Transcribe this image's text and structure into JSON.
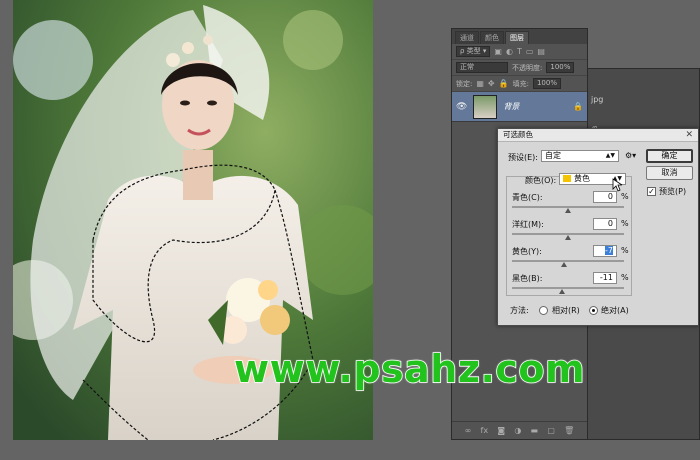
{
  "layers_panel": {
    "tabs": [
      "通道",
      "颜色",
      "图层"
    ],
    "active_tab": "图层",
    "filter_kind": "类型",
    "blend_mode": "正常",
    "opacity_label": "不透明度:",
    "opacity_value": "100%",
    "lock_label": "锁定:",
    "fill_label": "填充:",
    "fill_value": "100%",
    "layer_name": "背景",
    "footer_icons": [
      "link-icon",
      "fx-icon",
      "mask-icon",
      "adjustment-icon",
      "group-icon",
      "new-layer-icon",
      "trash-icon"
    ]
  },
  "back_panel": {
    "text_1": "jpg",
    "text_2": "像"
  },
  "dialog": {
    "title": "可选颜色",
    "preset_label": "预设(E):",
    "preset_value": "自定",
    "ok_label": "确定",
    "cancel_label": "取消",
    "preview_label": "预览(P)",
    "preview_checked": true,
    "color_label": "颜色(O):",
    "color_value": "黄色",
    "color_swatch": "#f5c400",
    "sliders": [
      {
        "label": "青色(C):",
        "value": "0",
        "unit": "%",
        "level": 0
      },
      {
        "label": "洋红(M):",
        "value": "0",
        "unit": "%",
        "level": 0
      },
      {
        "label": "黄色(Y):",
        "value": "-7",
        "unit": "%",
        "level": -7
      },
      {
        "label": "黑色(B):",
        "value": "-11",
        "unit": "%",
        "level": -11
      }
    ],
    "method_label": "方法:",
    "method_relative": "相对(R)",
    "method_absolute": "绝对(A)",
    "method_selected": "绝对(A)"
  },
  "watermark": "www.psahz.com",
  "colors": {
    "app_bg": "#646464",
    "panel_bg": "#535353",
    "layer_selected": "#647999",
    "dialog_bg": "#d6d6d6",
    "watermark": "#22c31d"
  }
}
